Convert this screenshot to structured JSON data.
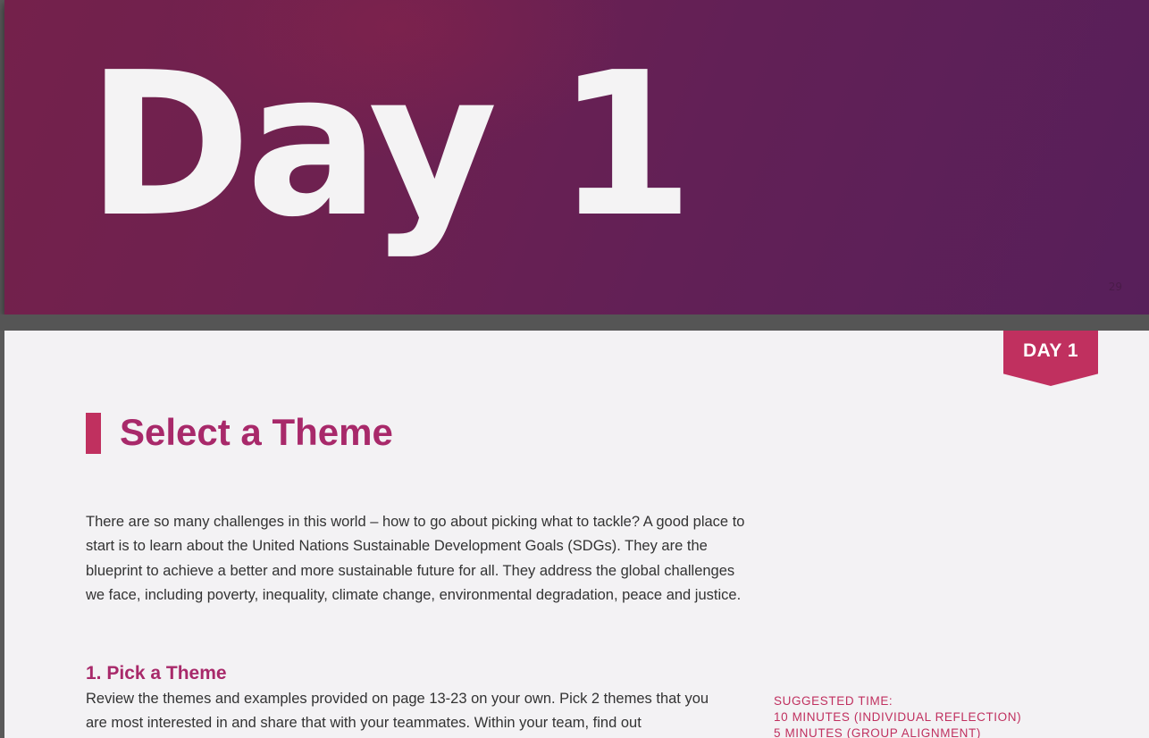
{
  "cover": {
    "title": "Day 1",
    "page_number": "29"
  },
  "page": {
    "ribbon_label": "DAY 1",
    "section_title": "Select a Theme",
    "intro": "There are so many challenges in this world – how to go about picking what to tackle? A good place to start is to learn about the United Nations Sustainable Development Goals (SDGs). They are the blueprint to achieve a better and more sustainable future for all. They address the global challenges we face, including poverty, inequality, climate change, environmental degradation, peace and justice.",
    "step_heading": "1. Pick a Theme",
    "step_text": "Review the themes and examples provided on page 13-23 on your own. Pick 2 themes that you are most interested in and share that with your teammates. Within your team, find out",
    "suggested_time": {
      "label": "SUGGESTED TIME:",
      "line1": "10 MINUTES (INDIVIDUAL REFLECTION)",
      "line2": "5 MINUTES (GROUP ALIGNMENT)"
    }
  },
  "colors": {
    "cover_gradient_start": "#74214b",
    "cover_gradient_end": "#571f5a",
    "accent": "#c0305f",
    "heading": "#a8296a",
    "body_text": "#333333",
    "page_background": "#f3f2f4"
  }
}
